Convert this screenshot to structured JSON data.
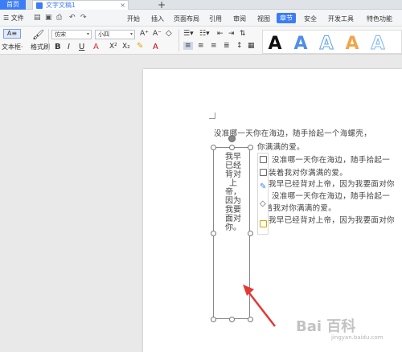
{
  "titlebar": {
    "home_tab": "首页",
    "doc_tab": "文字文稿1",
    "close": "×",
    "add_tab": "+"
  },
  "menubar": {
    "file": "文件",
    "items": [
      "开始",
      "插入",
      "页面布局",
      "引用",
      "审阅",
      "视图",
      "章节",
      "安全",
      "开发工具",
      "特色功能"
    ],
    "active": "章节"
  },
  "ribbon": {
    "textbox_label": "文本框·",
    "format_painter": "格式刷",
    "font_name": "仿宋",
    "font_size": "小四",
    "bold": "B",
    "italic": "I",
    "underline": "U",
    "grow_font": "A⁺",
    "shrink_font": "A⁻",
    "superscript": "X²",
    "subscript": "X₂",
    "wordart_letter": "A",
    "wordart_colors": [
      "#111111",
      "#4f8fe6",
      "#5aa1f0",
      "#f0a648",
      "#7ab4f5"
    ]
  },
  "document": {
    "lines": [
      "没准哪一天你在海边，随手拾起一个海螺壳，",
      "你满满的爱。",
      "没准哪一天你在海边，随手拾起一",
      "装着我对你满满的爱。",
      "我早已经背对上帝，因为我要面对你",
      "没准哪一天你在海边，随手拾起一",
      "装着我对你满满的爱。",
      "我早已经背对上帝，因为我要面对你"
    ],
    "vertical_text": "我早已经背对上帝，因为我要面对你。"
  },
  "watermark": {
    "brand": "Bai  百科",
    "sub": "jingyan.baidu.com"
  }
}
